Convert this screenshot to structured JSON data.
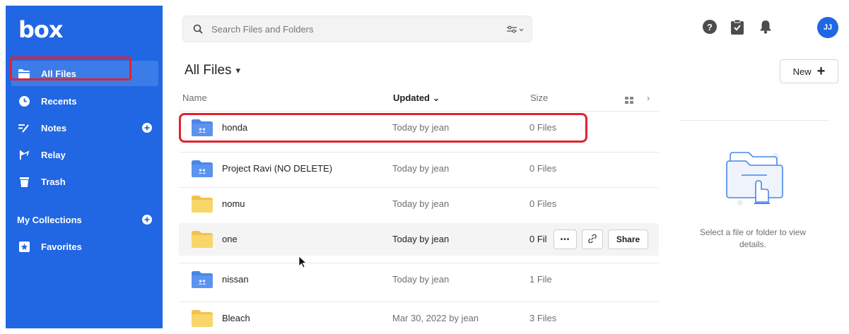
{
  "app": {
    "logo_text": "box"
  },
  "sidebar": {
    "items": [
      {
        "label": "All Files",
        "icon": "folder-icon",
        "active": true
      },
      {
        "label": "Recents",
        "icon": "clock-icon"
      },
      {
        "label": "Notes",
        "icon": "notes-icon",
        "action": "plus-circle-icon"
      },
      {
        "label": "Relay",
        "icon": "relay-icon"
      },
      {
        "label": "Trash",
        "icon": "trash-icon"
      }
    ],
    "collections_label": "My Collections",
    "collections_action": "plus-circle-icon",
    "favorites_label": "Favorites",
    "favorites_icon": "star-icon"
  },
  "search": {
    "placeholder": "Search Files and Folders"
  },
  "header_icons": [
    "help-icon",
    "tasks-icon",
    "bell-icon"
  ],
  "user": {
    "initials": "JJ"
  },
  "page": {
    "title": "All Files",
    "title_caret": "▾",
    "new_label": "New",
    "new_plus": "+"
  },
  "table": {
    "columns": {
      "name": "Name",
      "updated": "Updated",
      "updated_caret": "⌄",
      "size": "Size"
    },
    "rows": [
      {
        "name": "honda",
        "updated": "Today by jean",
        "size": "0 Files",
        "type": "shared-folder",
        "highlighted": true
      },
      {
        "name": "Project Ravi (NO DELETE)",
        "updated": "Today by jean",
        "size": "0 Files",
        "type": "shared-folder"
      },
      {
        "name": "nomu",
        "updated": "Today by jean",
        "size": "0 Files",
        "type": "folder"
      },
      {
        "name": "one",
        "updated": "Today by jean",
        "size": "0 Fil",
        "type": "folder",
        "hover": true
      },
      {
        "name": "nissan",
        "updated": "Today by jean",
        "size": "1 File",
        "type": "shared-folder"
      },
      {
        "name": "Bleach",
        "updated": "Mar 30, 2022 by jean",
        "size": "3 Files",
        "type": "folder"
      }
    ],
    "row_actions": {
      "more_label": "•••",
      "share_label": "Share"
    }
  },
  "details": {
    "empty_text": "Select a file or folder to view details."
  },
  "colors": {
    "brand": "#2166e3",
    "highlight": "#e3222e",
    "shared_folder": "#4a86e8",
    "folder": "#f8d66b"
  }
}
